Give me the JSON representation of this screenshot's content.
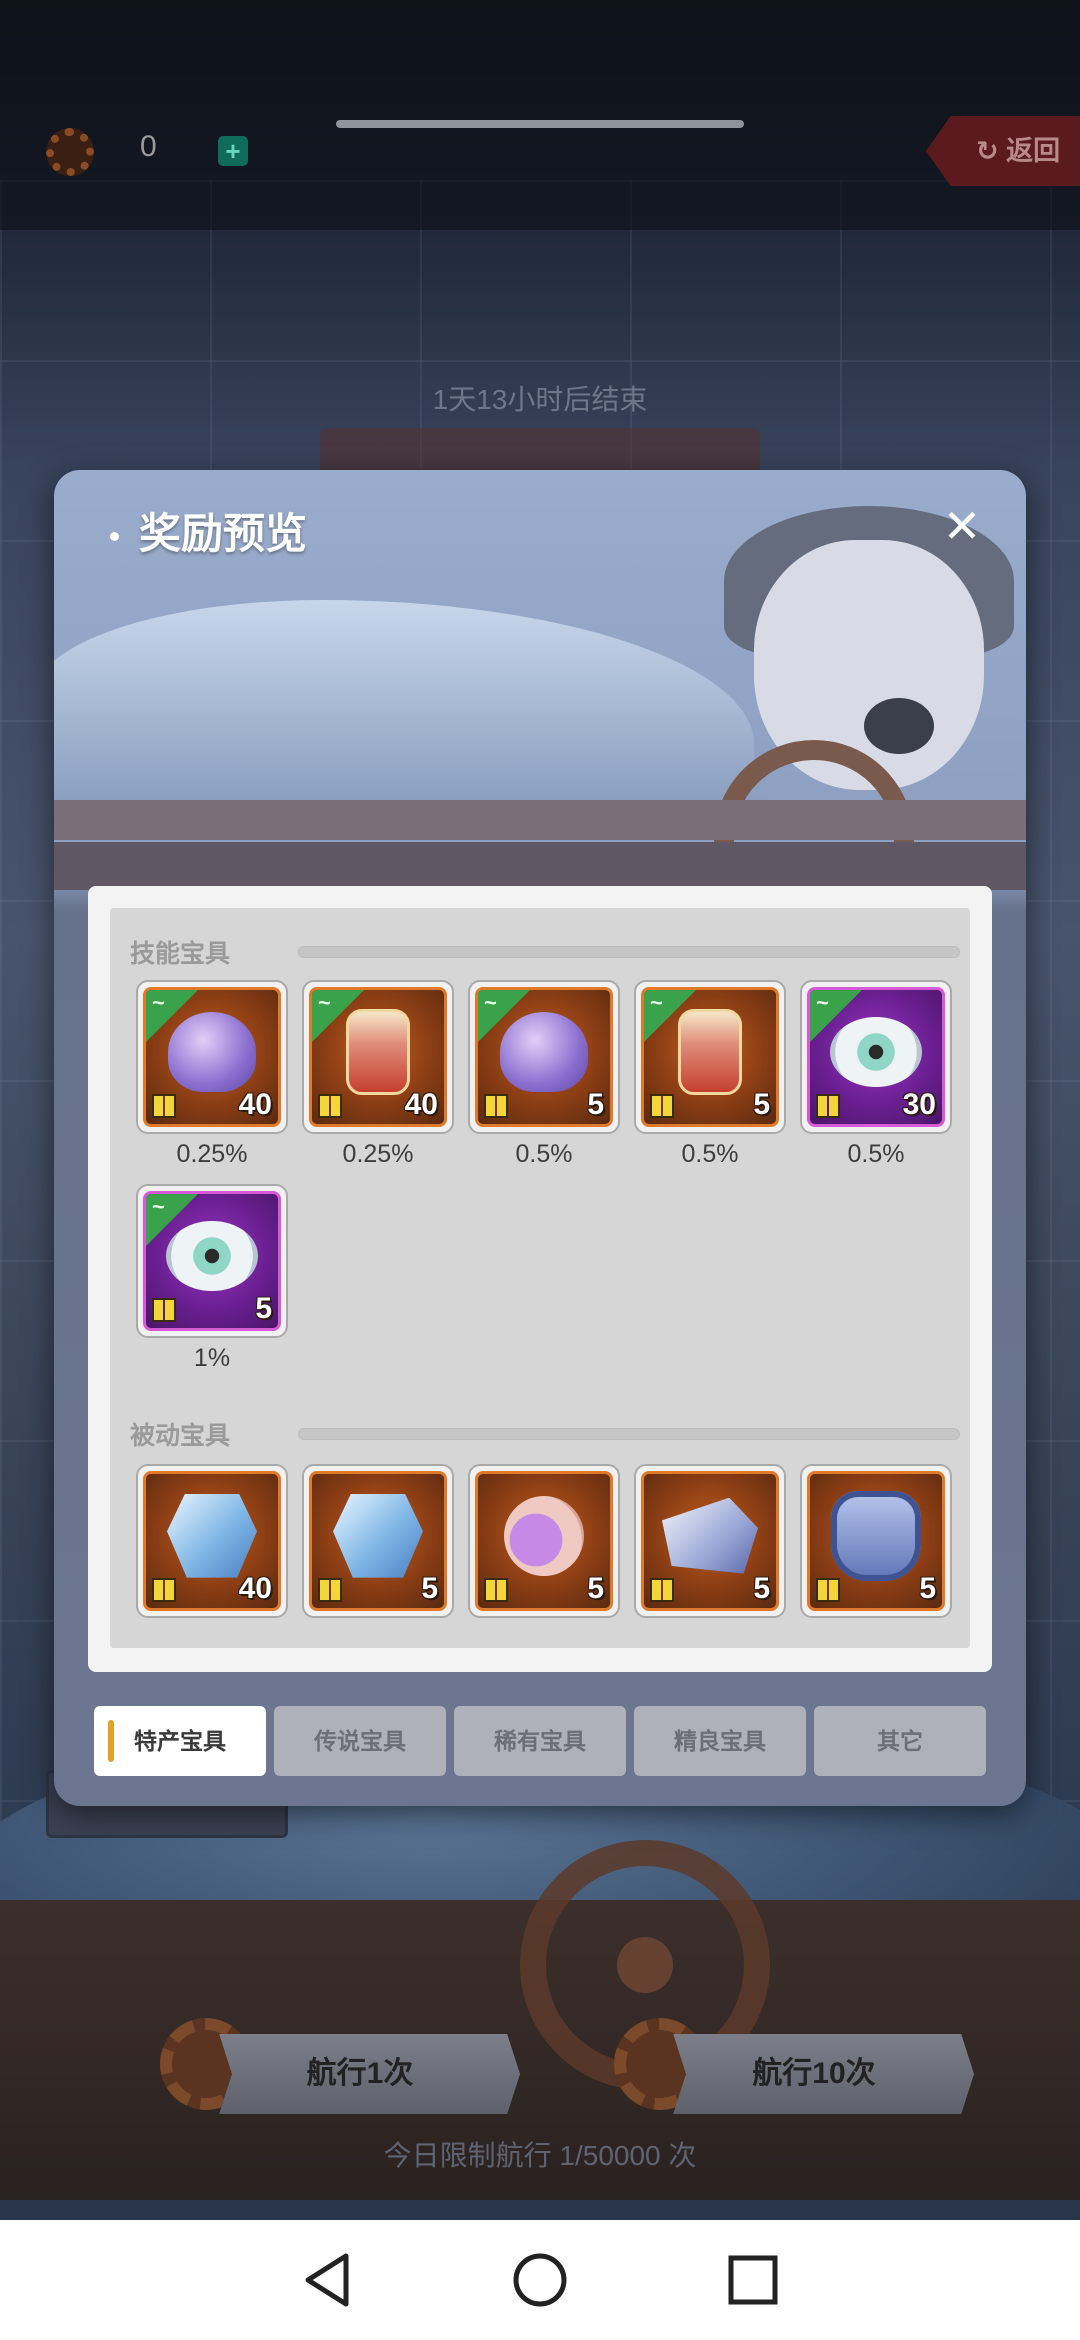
{
  "topbar": {
    "currency_value": "0",
    "back_label": "返回"
  },
  "event": {
    "timer": "1天13小时后结束"
  },
  "dialog": {
    "title": "奖励预览",
    "skill_section": "技能宝具",
    "passive_section": "被动宝具",
    "skill_items": [
      {
        "art": "purple-flower-icon",
        "frame": "orange",
        "qty": "40",
        "chance": "0.25%"
      },
      {
        "art": "lantern-icon",
        "frame": "orange",
        "qty": "40",
        "chance": "0.25%"
      },
      {
        "art": "purple-flower-icon",
        "frame": "orange",
        "qty": "5",
        "chance": "0.5%"
      },
      {
        "art": "lantern-icon",
        "frame": "orange",
        "qty": "5",
        "chance": "0.5%"
      },
      {
        "art": "winged-eye-icon",
        "frame": "purple",
        "qty": "30",
        "chance": "0.5%"
      },
      {
        "art": "winged-eye-icon",
        "frame": "purple",
        "qty": "5",
        "chance": "1%"
      }
    ],
    "passive_items": [
      {
        "art": "crystal-icon",
        "qty": "40"
      },
      {
        "art": "crystal-icon",
        "qty": "5"
      },
      {
        "art": "potion-chain-icon",
        "qty": "5"
      },
      {
        "art": "ship-cannon-icon",
        "qty": "5"
      },
      {
        "art": "armor-icon",
        "qty": "5"
      }
    ],
    "tabs": [
      "特产宝具",
      "传说宝具",
      "稀有宝具",
      "精良宝具",
      "其它"
    ],
    "active_tab": 0
  },
  "bottom": {
    "sail_one_label": "航行1次",
    "sail_one_badge": "1",
    "sail_ten_label": "航行10次",
    "sail_ten_badge": "10",
    "limit_text": "今日限制航行 1/50000 次"
  },
  "colors": {
    "orange_frame": "#e07a2a",
    "purple_frame": "#d65ad6",
    "tab_accent": "#e2a12a"
  }
}
